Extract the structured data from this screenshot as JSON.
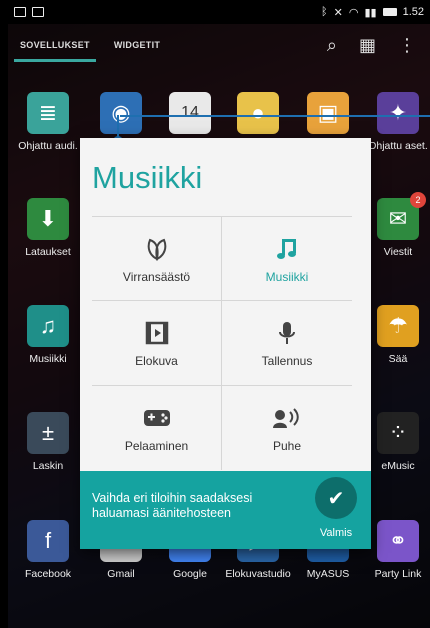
{
  "status_bar": {
    "time": "1.52"
  },
  "tabs": [
    {
      "label": "SOVELLUKSET",
      "active": true
    },
    {
      "label": "WIDGETIT",
      "active": false
    }
  ],
  "apps": [
    {
      "label": "Ohjattu audi.",
      "icon": "equalizer-icon",
      "color": "#3aa39a"
    },
    {
      "label": "",
      "icon": "camera-icon",
      "color": "#2d6fb5"
    },
    {
      "label": "",
      "icon": "calendar-icon",
      "color": "#e9e9e9",
      "text": "14"
    },
    {
      "label": "",
      "icon": "balloon-icon",
      "color": "#e8c24a"
    },
    {
      "label": "",
      "icon": "gallery-icon",
      "color": "#e8a23b"
    },
    {
      "label": "Ohjattu aset.",
      "icon": "setup-wizard-icon",
      "color": "#5a3f9a"
    },
    {
      "label": "Lataukset",
      "icon": "download-icon",
      "color": "#2e8a3f"
    },
    {
      "label": "Viestit",
      "icon": "messages-icon",
      "color": "#2e8a3f",
      "badge": "2"
    },
    {
      "label": "Musiikki",
      "icon": "music-icon",
      "color": "#1f8f89"
    },
    {
      "label": "Sää",
      "icon": "weather-icon",
      "color": "#e0a020"
    },
    {
      "label": "Laskin",
      "icon": "calculator-icon",
      "color": "#3a4a5a"
    },
    {
      "label": "eMusic",
      "icon": "emusic-icon",
      "color": "#222222"
    },
    {
      "label": "Facebook",
      "icon": "facebook-icon",
      "color": "#3b5998"
    },
    {
      "label": "Gmail",
      "icon": "gmail-icon",
      "color": "#d0d0d0"
    },
    {
      "label": "Google",
      "icon": "google-icon",
      "color": "#4285f4"
    },
    {
      "label": "Elokuvastudio",
      "icon": "movie-studio-icon",
      "color": "#2a66a8"
    },
    {
      "label": "MyASUS",
      "icon": "myasus-icon",
      "color": "#1f5fa8"
    },
    {
      "label": "Party Link",
      "icon": "party-link-icon",
      "color": "#7b55c9"
    }
  ],
  "dialog": {
    "title": "Musiikki",
    "modes": [
      {
        "label": "Virransäästö",
        "icon": "leaf-icon",
        "selected": false
      },
      {
        "label": "Musiikki",
        "icon": "music-note-icon",
        "selected": true
      },
      {
        "label": "Elokuva",
        "icon": "film-icon",
        "selected": false
      },
      {
        "label": "Tallennus",
        "icon": "microphone-icon",
        "selected": false
      },
      {
        "label": "Pelaaminen",
        "icon": "gamepad-icon",
        "selected": false
      },
      {
        "label": "Puhe",
        "icon": "speaker-voice-icon",
        "selected": false
      }
    ],
    "footer_text": "Vaihda eri tiloihin saadaksesi haluamasi äänitehosteen",
    "done_label": "Valmis"
  }
}
